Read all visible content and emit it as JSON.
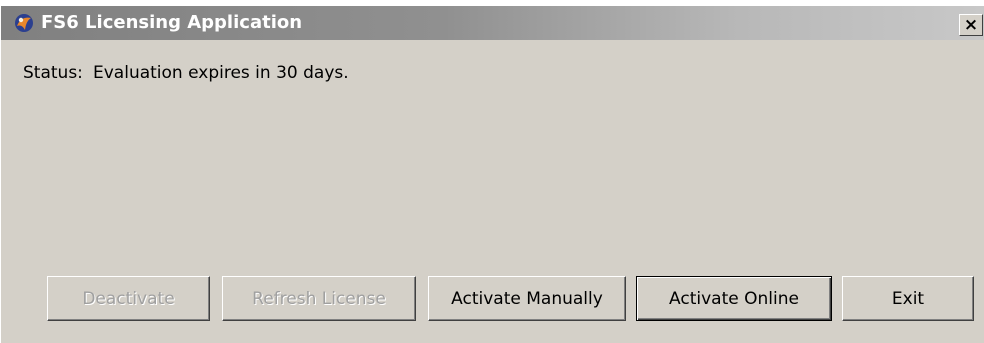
{
  "window": {
    "title": "FS6 Licensing Application",
    "close_glyph": "×",
    "app_icon": "fs6-app-icon"
  },
  "status": {
    "label": "Status:",
    "value": "Evaluation expires in 30 days."
  },
  "buttons": {
    "deactivate": {
      "label": "Deactivate",
      "enabled": false
    },
    "refresh_license": {
      "label": "Refresh License",
      "enabled": false
    },
    "activate_manually": {
      "label": "Activate Manually",
      "enabled": true
    },
    "activate_online": {
      "label": "Activate Online",
      "enabled": true,
      "default": true
    },
    "exit": {
      "label": "Exit",
      "enabled": true
    }
  },
  "colors": {
    "window_bg": "#d4d0c8",
    "titlebar_inactive": "#808080",
    "disabled_text": "#a0a0a0"
  }
}
